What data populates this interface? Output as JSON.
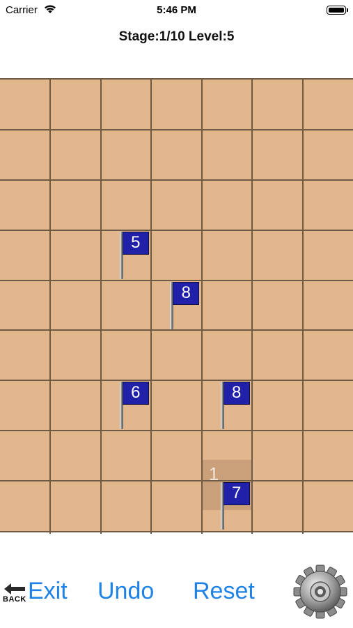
{
  "status_bar": {
    "carrier": "Carrier",
    "time": "5:46 PM"
  },
  "header": {
    "title": "Stage:1/10 Level:5"
  },
  "board": {
    "columns": 7,
    "rows": 9,
    "selected_cell": {
      "col": 4,
      "row": 6,
      "number": "1"
    },
    "flags": [
      {
        "col": 2,
        "row": 3,
        "number": "5"
      },
      {
        "col": 3,
        "row": 4,
        "number": "8"
      },
      {
        "col": 2,
        "row": 6,
        "number": "6"
      },
      {
        "col": 4,
        "row": 6,
        "number": "8"
      },
      {
        "col": 4,
        "row": 8,
        "number": "7"
      }
    ],
    "colors": {
      "cell": "#e3b78e",
      "grid_line": "#6e5a45",
      "flag": "#2020a8",
      "selected": "#c9a07a"
    }
  },
  "toolbar": {
    "back_label": "BACK",
    "exit_label": "Exit",
    "undo_label": "Undo",
    "reset_label": "Reset",
    "settings_icon": "gear-icon",
    "accent_color": "#1f82e6"
  }
}
